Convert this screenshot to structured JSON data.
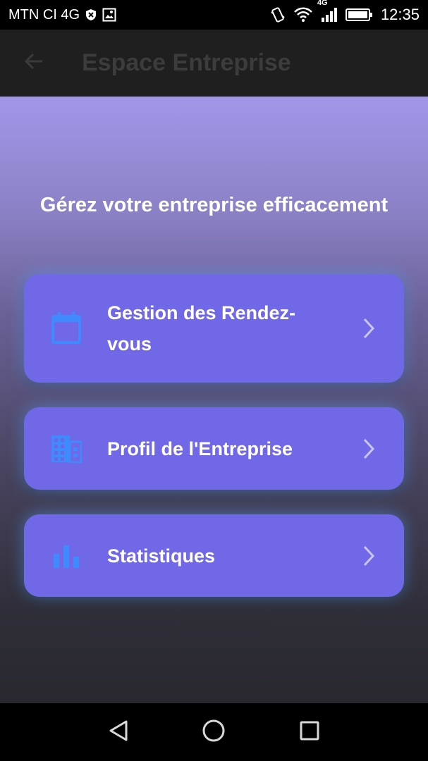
{
  "status_bar": {
    "carrier": "MTN CI 4G",
    "network_badge": "4G",
    "time": "12:35",
    "icons": [
      "shield-icon",
      "image-icon",
      "vibrate-icon",
      "wifi-icon",
      "signal-icon",
      "battery-icon"
    ]
  },
  "app_bar": {
    "title": "Espace Entreprise",
    "back_icon": "arrow-back-icon"
  },
  "main": {
    "headline": "Gérez votre entreprise efficacement",
    "cards": [
      {
        "label": "Gestion des Rendez-vous",
        "icon": "calendar-icon"
      },
      {
        "label": "Profil de l'Entreprise",
        "icon": "building-icon"
      },
      {
        "label": "Statistiques",
        "icon": "bar-chart-icon"
      }
    ]
  },
  "nav_bar": {
    "buttons": [
      "back-triangle-icon",
      "home-circle-icon",
      "recents-square-icon"
    ]
  },
  "colors": {
    "card": "#7068e6",
    "icon_accent": "#3d8bff",
    "gradient_top": "#a197e9",
    "gradient_bottom": "#29282f"
  }
}
